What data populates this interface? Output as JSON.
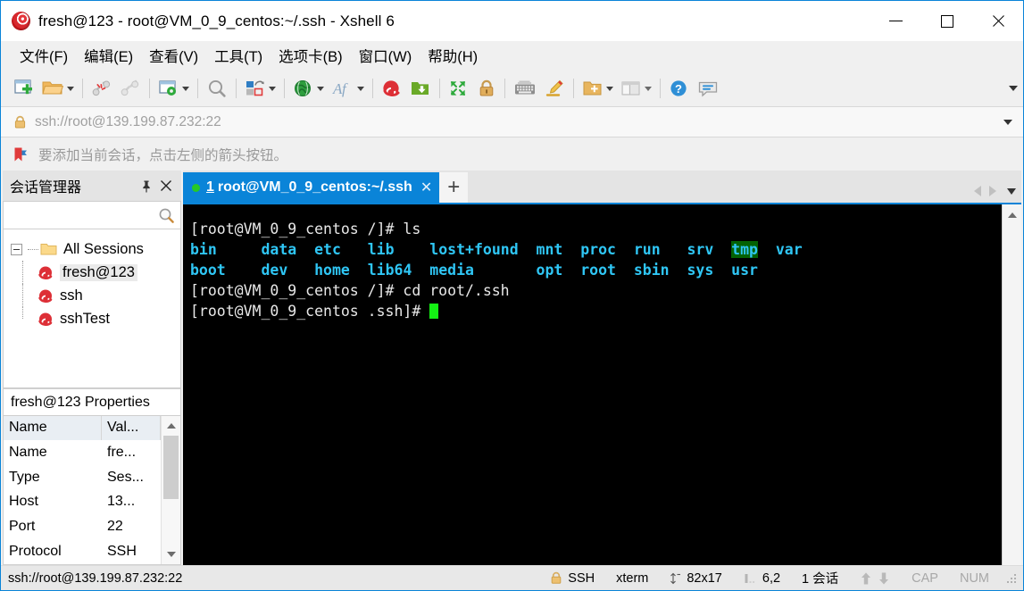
{
  "window": {
    "title": "fresh@123 - root@VM_0_9_centos:~/.ssh - Xshell 6",
    "app_icon": "xshell-icon",
    "minimize_label": "—",
    "maximize_label": "□",
    "close_label": "✕"
  },
  "menubar": {
    "items": [
      {
        "label": "文件(F)",
        "name": "menu-file"
      },
      {
        "label": "编辑(E)",
        "name": "menu-edit"
      },
      {
        "label": "查看(V)",
        "name": "menu-view"
      },
      {
        "label": "工具(T)",
        "name": "menu-tools"
      },
      {
        "label": "选项卡(B)",
        "name": "menu-tabs"
      },
      {
        "label": "窗口(W)",
        "name": "menu-window"
      },
      {
        "label": "帮助(H)",
        "name": "menu-help"
      }
    ]
  },
  "toolbar": {
    "icons": [
      "new-session-icon",
      "open-folder-icon",
      "disconnect-icon",
      "reconnect-icon",
      "session-properties-icon",
      "find-icon",
      "layout-icon",
      "globe-icon",
      "font-icon",
      "xshell-icon",
      "xftp-icon",
      "fullscreen-icon",
      "lock-icon",
      "keyboard-icon",
      "highlight-icon",
      "add-folder-icon",
      "split-view-icon",
      "help-icon",
      "feedback-icon"
    ],
    "overflow_label": "▾"
  },
  "address_bar": {
    "value": "ssh://root@139.199.87.232:22",
    "placeholder": "ssh://root@139.199.87.232:22",
    "lock_icon": "lock-icon",
    "dropdown_icon": "chevron-down-icon"
  },
  "notice": {
    "icon": "bookmark-flag-icon",
    "text": "要添加当前会话，点击左侧的箭头按钮。"
  },
  "session_manager": {
    "title": "会话管理器",
    "pin_icon": "pin-icon",
    "close_icon": "close-icon",
    "search": {
      "value": "",
      "placeholder": "",
      "icon": "search-icon"
    },
    "tree": {
      "root_label": "All Sessions",
      "root_icon": "folder-icon",
      "expander": "collapse-toggle",
      "items": [
        {
          "label": "fresh@123",
          "icon": "session-icon",
          "selected": true
        },
        {
          "label": "ssh",
          "icon": "session-icon",
          "selected": false
        },
        {
          "label": "sshTest",
          "icon": "session-icon",
          "selected": false
        }
      ]
    }
  },
  "properties": {
    "title": "fresh@123 Properties",
    "columns": [
      "Name",
      "Val..."
    ],
    "rows": [
      {
        "name": "Name",
        "value": "fre..."
      },
      {
        "name": "Type",
        "value": "Ses..."
      },
      {
        "name": "Host",
        "value": "13..."
      },
      {
        "name": "Port",
        "value": "22"
      },
      {
        "name": "Protocol",
        "value": "SSH"
      }
    ],
    "scroll_up": "⌃",
    "scroll_down": "⌄"
  },
  "tabs": {
    "items": [
      {
        "number": "1",
        "title": "root@VM_0_9_centos:~/.ssh",
        "status_dot_color": "#26c926",
        "close_label": "✕",
        "active": true
      }
    ],
    "new_tab_label": "+",
    "nav_prev": "prev-tab-icon",
    "nav_next": "next-tab-icon",
    "tab_list": "tab-list-icon"
  },
  "terminal": {
    "lines": [
      {
        "type": "prompt",
        "text": "[root@VM_0_9_centos /]# ls"
      },
      {
        "type": "ls",
        "entries": [
          {
            "text": "bin",
            "style": "dir"
          },
          {
            "text": "data",
            "style": "dir"
          },
          {
            "text": "etc",
            "style": "dir"
          },
          {
            "text": "lib",
            "style": "dir"
          },
          {
            "text": "lost+found",
            "style": "dir"
          },
          {
            "text": "mnt",
            "style": "dir"
          },
          {
            "text": "proc",
            "style": "dir"
          },
          {
            "text": "run",
            "style": "dir"
          },
          {
            "text": "srv",
            "style": "dir"
          },
          {
            "text": "tmp",
            "style": "dir-sticky"
          },
          {
            "text": "var",
            "style": "dir"
          }
        ]
      },
      {
        "type": "ls",
        "entries": [
          {
            "text": "boot",
            "style": "dir"
          },
          {
            "text": "dev",
            "style": "dir"
          },
          {
            "text": "home",
            "style": "dir"
          },
          {
            "text": "lib64",
            "style": "dir"
          },
          {
            "text": "media",
            "style": "dir"
          },
          {
            "text": "opt",
            "style": "dir"
          },
          {
            "text": "root",
            "style": "dir"
          },
          {
            "text": "sbin",
            "style": "dir"
          },
          {
            "text": "sys",
            "style": "dir"
          },
          {
            "text": "usr",
            "style": "dir"
          }
        ]
      },
      {
        "type": "prompt",
        "text": "[root@VM_0_9_centos /]# cd root/.ssh"
      },
      {
        "type": "prompt-cursor",
        "text": "[root@VM_0_9_centos .ssh]# "
      }
    ],
    "raw_row1": "bin     data  etc   lib    lost+found  mnt  proc  run   srv  tmp  var",
    "raw_row2": "boot    dev   home  lib64  media       opt  root  sbin  sys  usr",
    "cursor_color": "#14f214",
    "fg_color": "#e8e8e8",
    "dir_color": "#2fc6f5",
    "bg_color": "#000000"
  },
  "statusbar": {
    "connection": "ssh://root@139.199.87.232:22",
    "lock_icon": "lock-icon",
    "protocol": "SSH",
    "term_type": "xterm",
    "size_icon": "resize-icon",
    "size": "82x17",
    "cursor_icon": "column-icon",
    "cursor_pos": "6,2",
    "sessions": "1 会话",
    "upload_icon": "upload-arrow-icon",
    "download_icon": "download-arrow-icon",
    "caps": "CAP",
    "num": "NUM",
    "grip": "resize-grip"
  }
}
